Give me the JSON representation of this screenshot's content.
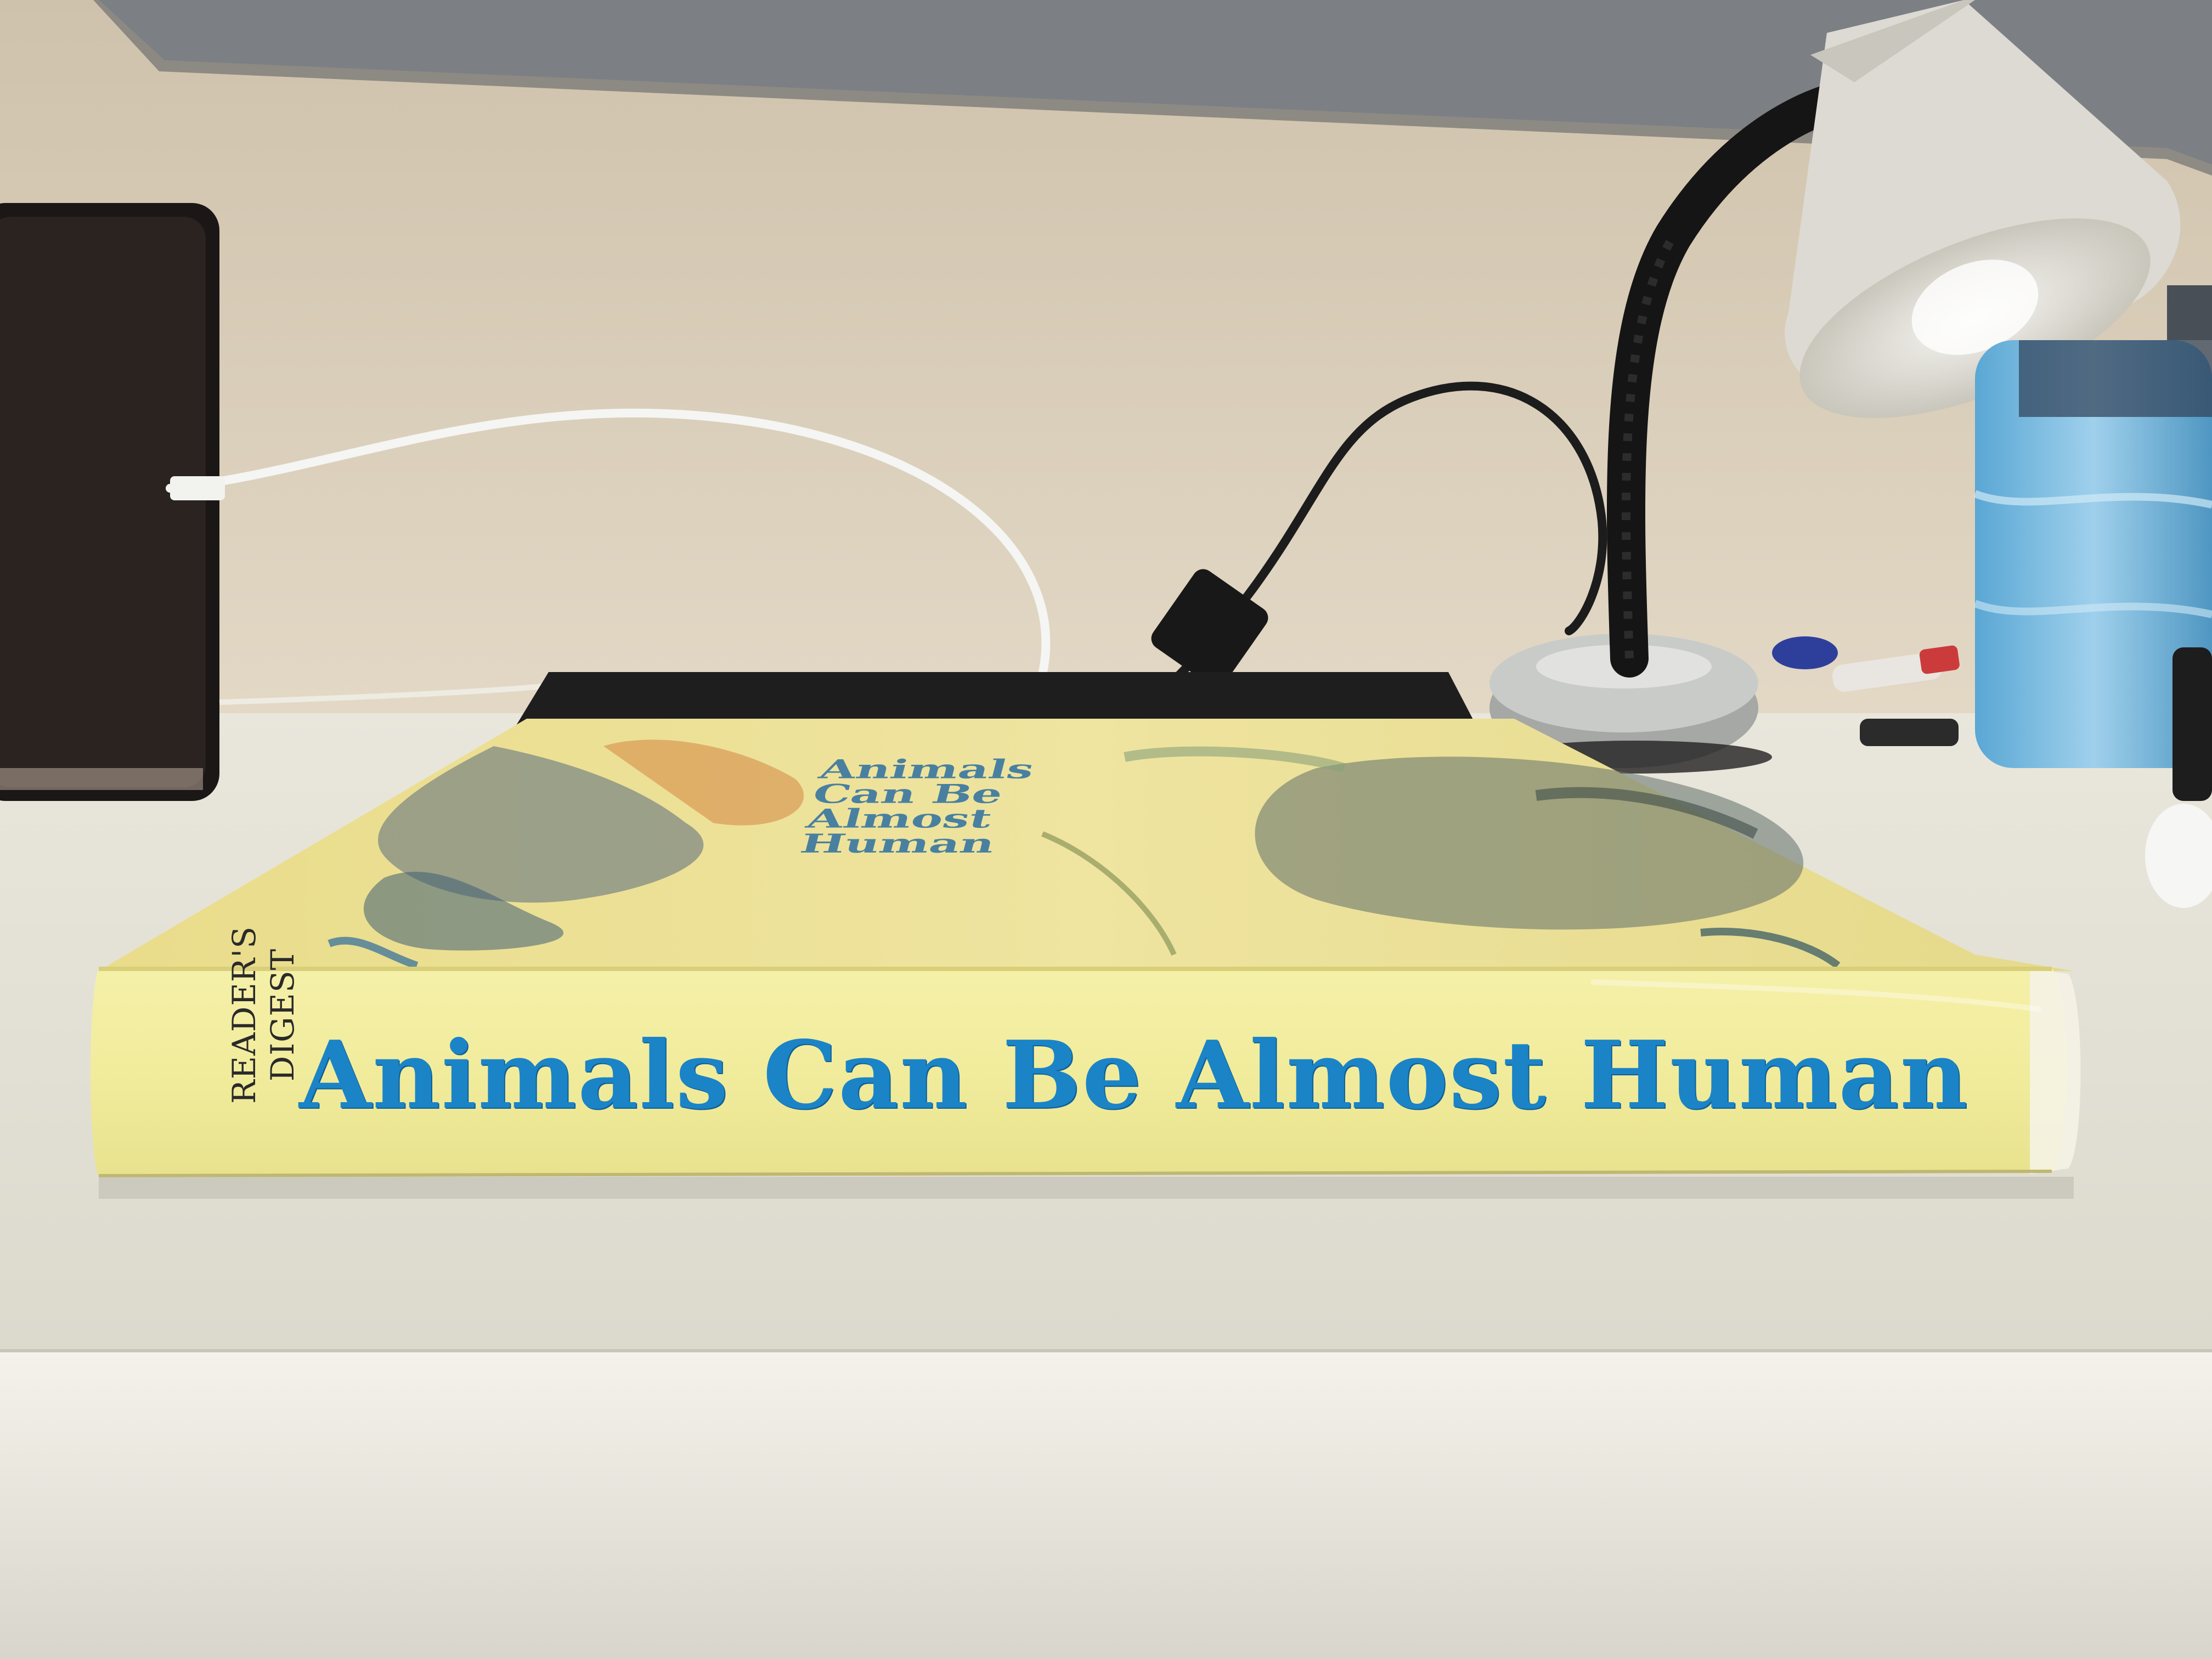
{
  "photo": {
    "subject": "book-spine",
    "colors": {
      "wall": "#d9cdb8",
      "desk": "#e8e6da",
      "book_jacket": "#f2ec9a",
      "title_blue": "#1b84c7",
      "laptop": "#1e1e1e",
      "lamp_shade": "#dedbd0"
    }
  },
  "book": {
    "publisher_line1": "READER'S",
    "publisher_line2": "DIGEST",
    "spine_title": "Animals Can Be Almost Human",
    "cover_title_line1": "Animals",
    "cover_title_line2": "Can Be",
    "cover_title_line3": "Almost",
    "cover_title_line4": "Human"
  }
}
